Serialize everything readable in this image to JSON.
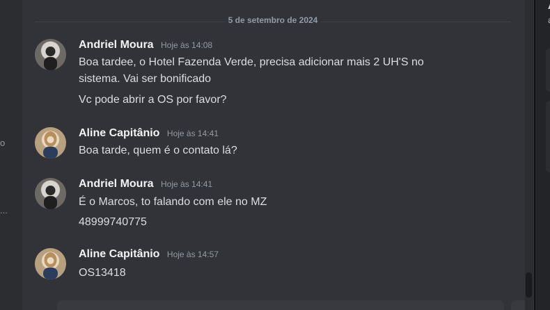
{
  "left_sidebar": {
    "fragment_1": "o",
    "fragment_2": "..."
  },
  "chat": {
    "date_divider": "5 de setembro de 2024",
    "messages": [
      {
        "author": "Andriel Moura",
        "time": "Hoje às 14:08",
        "lines": [
          "Boa tardee, o Hotel Fazenda Verde, precisa adicionar mais 2 UH'S no",
          "sistema. Vai ser bonificado",
          "Vc pode abrir a OS por favor?"
        ]
      },
      {
        "author": "Aline Capitânio",
        "time": "Hoje às 14:41",
        "lines": [
          "Boa tarde, quem é o contato lá?"
        ]
      },
      {
        "author": "Andriel Moura",
        "time": "Hoje às 14:41",
        "lines": [
          "É o Marcos, to falando com ele no MZ",
          "48999740775"
        ]
      },
      {
        "author": "Aline Capitânio",
        "time": "Hoje às 14:57",
        "lines": [
          "OS13418"
        ]
      }
    ]
  },
  "right_panel": {
    "fragment_1": "A",
    "fragment_2": "a"
  },
  "colors": {
    "chat_background": "#313338",
    "sidebar_background": "#2b2d31",
    "author_text": "#f2f3f5",
    "message_text": "#dbdee1",
    "muted_text": "#949ba4"
  }
}
